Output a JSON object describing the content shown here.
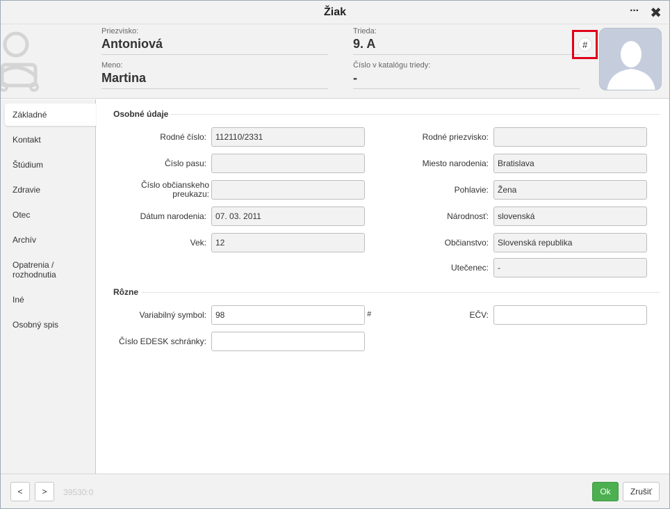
{
  "window": {
    "title": "Žiak",
    "more_label": "···",
    "close_label": "✖"
  },
  "header": {
    "surname_label": "Priezvisko:",
    "surname": "Antoniová",
    "name_label": "Meno:",
    "name": "Martina",
    "class_label": "Trieda:",
    "class": "9. A",
    "catalog_label": "Číslo v katalógu triedy:",
    "catalog": "-",
    "hash_icon": "#"
  },
  "sidebar": {
    "items": [
      {
        "label": "Základné"
      },
      {
        "label": "Kontakt"
      },
      {
        "label": "Štúdium"
      },
      {
        "label": "Zdravie"
      },
      {
        "label": "Otec"
      },
      {
        "label": "Archív"
      },
      {
        "label": "Opatrenia / rozhodnutia"
      },
      {
        "label": "Iné"
      },
      {
        "label": "Osobný spis"
      }
    ]
  },
  "personal": {
    "section": "Osobné údaje",
    "birth_number_label": "Rodné číslo:",
    "birth_number": "112110/2331",
    "passport_label": "Číslo pasu:",
    "passport": "",
    "id_card_label": "Číslo občianskeho preukazu:",
    "id_card": "",
    "birth_date_label": "Dátum narodenia:",
    "birth_date": "07. 03. 2011",
    "age_label": "Vek:",
    "age": "12",
    "maiden_name_label": "Rodné priezvisko:",
    "maiden_name": "",
    "birth_place_label": "Miesto narodenia:",
    "birth_place": "Bratislava",
    "gender_label": "Pohlavie:",
    "gender": "Žena",
    "nationality_label": "Národnosť:",
    "nationality": "slovenská",
    "citizenship_label": "Občianstvo:",
    "citizenship": "Slovenská republika",
    "refugee_label": "Utečenec:",
    "refugee": "-"
  },
  "misc": {
    "section": "Rôzne",
    "variable_symbol_label": "Variabilný symbol:",
    "variable_symbol": "98",
    "hash_icon": "#",
    "edesk_label": "Číslo EDESK schránky:",
    "edesk": "",
    "ecv_label": "EČV:",
    "ecv": ""
  },
  "footer": {
    "prev_label": "<",
    "next_label": ">",
    "record_id": "39530:0",
    "ok_label": "Ok",
    "cancel_label": "Zrušiť"
  },
  "colors": {
    "ok": "#4caf50",
    "highlight": "#e0001b",
    "avatar_bg": "#c5cddd"
  }
}
